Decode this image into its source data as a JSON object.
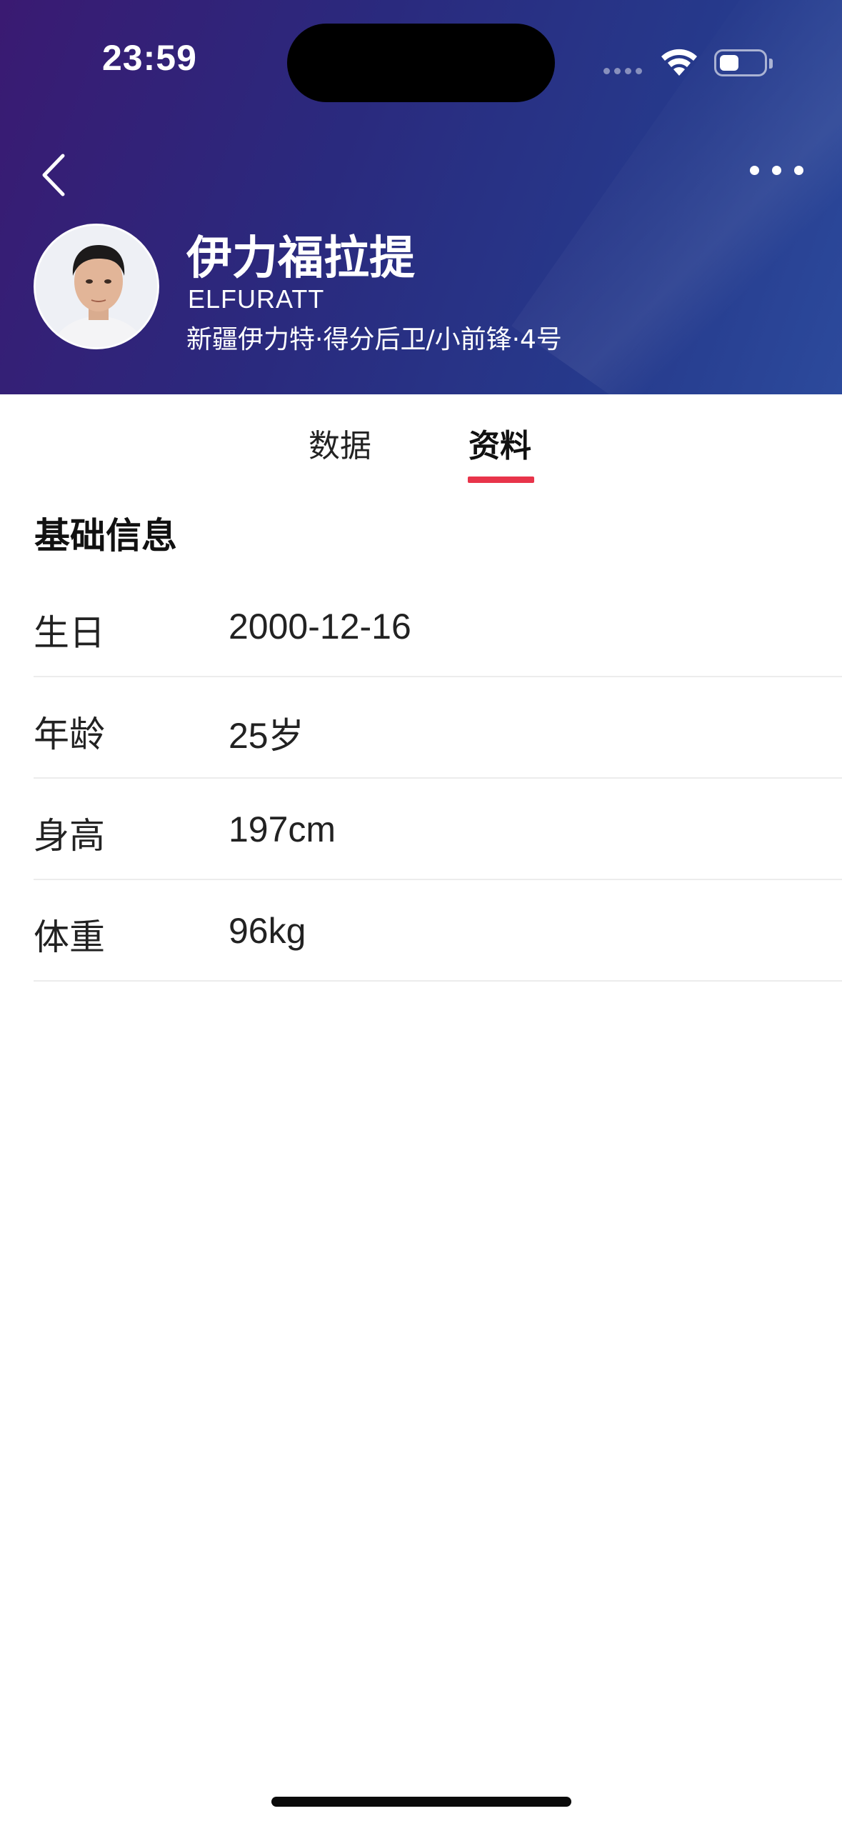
{
  "status_bar": {
    "time": "23:59"
  },
  "header": {
    "player_name": "伊力福拉提",
    "player_name_en": "ELFURATT",
    "player_meta": "新疆伊力特·得分后卫/小前锋·4号"
  },
  "icons": {
    "back": "chevron-left-icon",
    "more": "more-dots-icon",
    "wifi": "wifi-icon",
    "battery": "battery-icon"
  },
  "tabs": [
    {
      "label": "数据",
      "active": false
    },
    {
      "label": "资料",
      "active": true
    }
  ],
  "section": {
    "title": "基础信息"
  },
  "info": [
    {
      "label": "生日",
      "value": "2000-12-16"
    },
    {
      "label": "年龄",
      "value": "25岁"
    },
    {
      "label": "身高",
      "value": "197cm"
    },
    {
      "label": "体重",
      "value": "96kg"
    }
  ],
  "colors": {
    "accent": "#e8344a",
    "header_start": "#3a1a72",
    "header_end": "#2c4a9c"
  }
}
